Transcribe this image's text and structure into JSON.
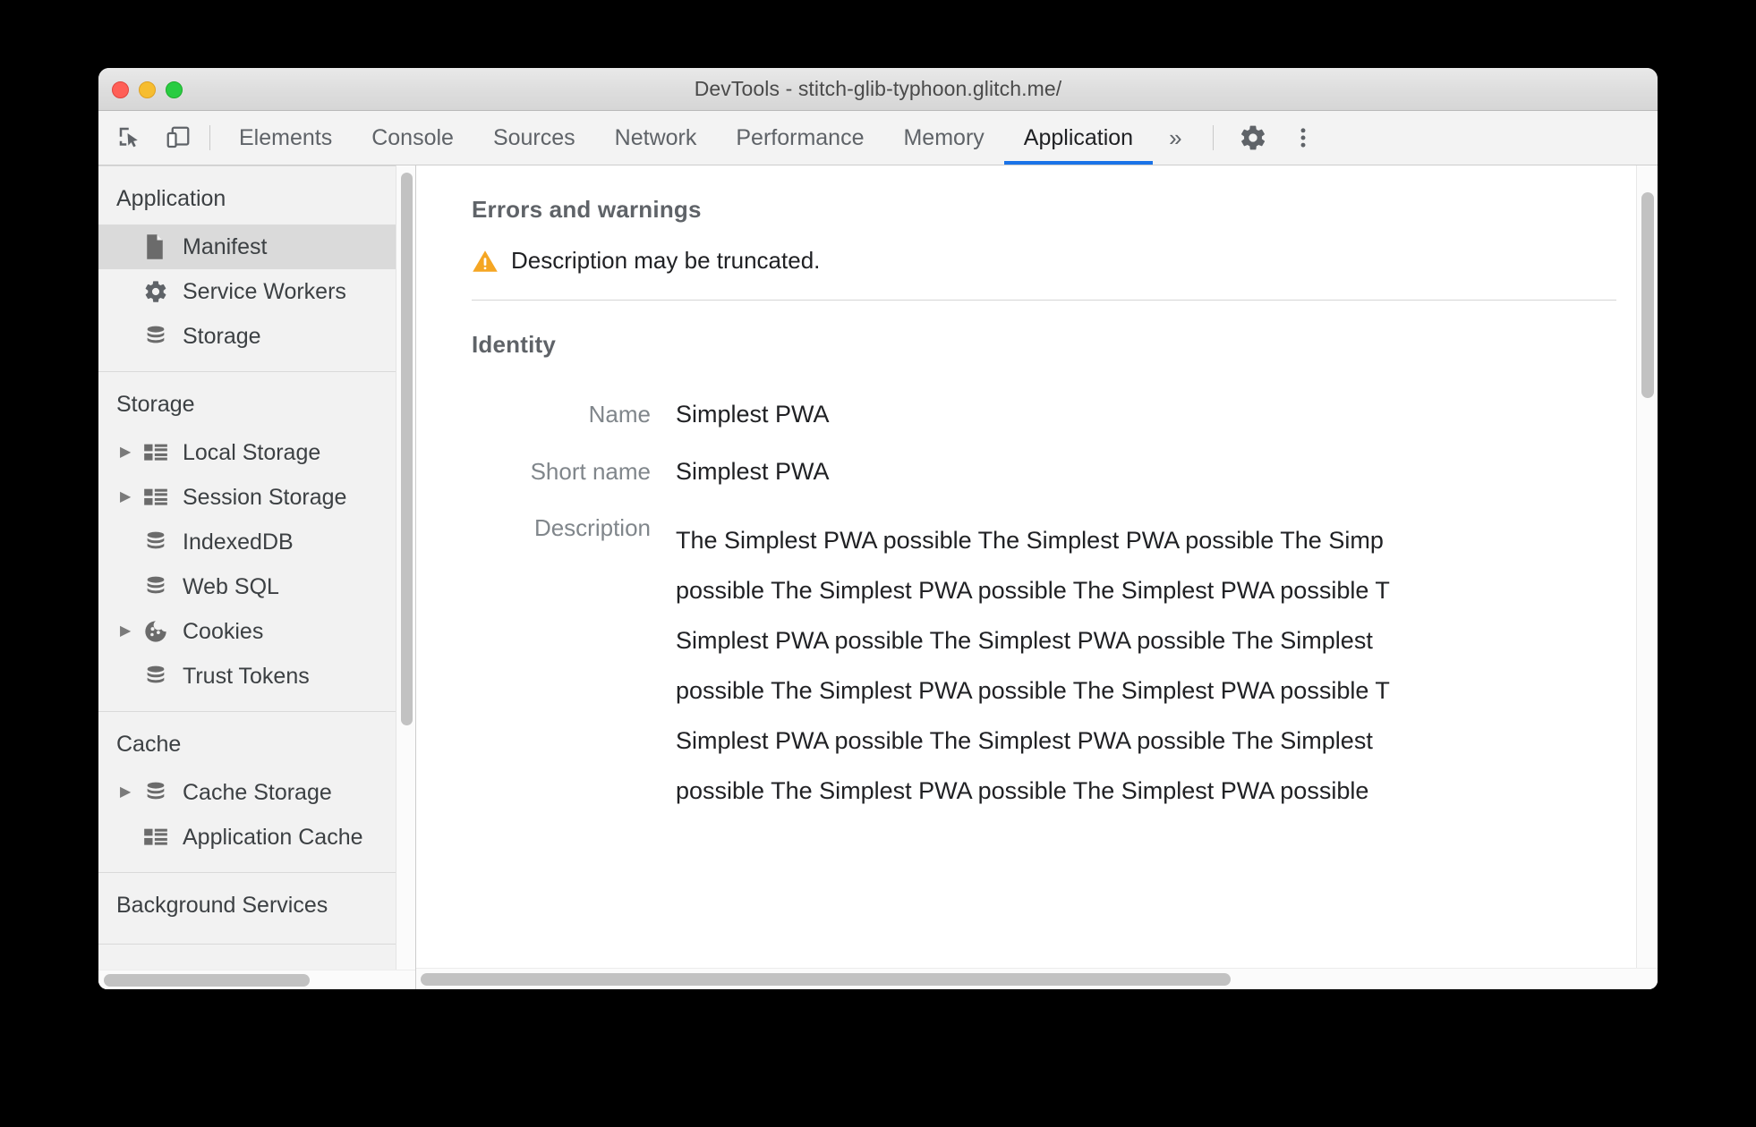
{
  "window": {
    "title": "DevTools - stitch-glib-typhoon.glitch.me/",
    "traffic_lights": [
      "close",
      "minimize",
      "zoom"
    ]
  },
  "toolbar": {
    "inspect_icon": "inspect-element-icon",
    "device_icon": "device-toolbar-icon",
    "more_tabs_label": "»",
    "settings_icon": "gear-icon",
    "more_options_icon": "kebab-menu-icon",
    "tabs": [
      {
        "label": "Elements",
        "active": false
      },
      {
        "label": "Console",
        "active": false
      },
      {
        "label": "Sources",
        "active": false
      },
      {
        "label": "Network",
        "active": false
      },
      {
        "label": "Performance",
        "active": false
      },
      {
        "label": "Memory",
        "active": false
      },
      {
        "label": "Application",
        "active": true
      }
    ],
    "active_tab": "Application",
    "accent_color": "#1a73e8"
  },
  "sidebar": {
    "groups": [
      {
        "title": "Application",
        "items": [
          {
            "label": "Manifest",
            "icon": "document-icon",
            "selected": true,
            "expandable": false
          },
          {
            "label": "Service Workers",
            "icon": "gear-icon",
            "selected": false,
            "expandable": false
          },
          {
            "label": "Storage",
            "icon": "database-icon",
            "selected": false,
            "expandable": false
          }
        ]
      },
      {
        "title": "Storage",
        "items": [
          {
            "label": "Local Storage",
            "icon": "table-icon",
            "selected": false,
            "expandable": true
          },
          {
            "label": "Session Storage",
            "icon": "table-icon",
            "selected": false,
            "expandable": true
          },
          {
            "label": "IndexedDB",
            "icon": "database-icon",
            "selected": false,
            "expandable": false
          },
          {
            "label": "Web SQL",
            "icon": "database-icon",
            "selected": false,
            "expandable": false
          },
          {
            "label": "Cookies",
            "icon": "cookie-icon",
            "selected": false,
            "expandable": true
          },
          {
            "label": "Trust Tokens",
            "icon": "database-icon",
            "selected": false,
            "expandable": false
          }
        ]
      },
      {
        "title": "Cache",
        "items": [
          {
            "label": "Cache Storage",
            "icon": "database-icon",
            "selected": false,
            "expandable": true
          },
          {
            "label": "Application Cache",
            "icon": "table-icon",
            "selected": false,
            "expandable": false
          }
        ]
      },
      {
        "title": "Background Services",
        "items": []
      }
    ]
  },
  "main": {
    "errors_section": {
      "heading": "Errors and warnings",
      "warning_icon": "warning-triangle-icon",
      "warning_color": "#f5a623",
      "message": "Description may be truncated."
    },
    "identity_section": {
      "heading": "Identity",
      "fields": [
        {
          "label": "Name",
          "value": "Simplest PWA"
        },
        {
          "label": "Short name",
          "value": "Simplest PWA"
        }
      ],
      "description_label": "Description",
      "description_lines": [
        "The Simplest PWA possible The Simplest PWA possible The Simp",
        "possible The Simplest PWA possible The Simplest PWA possible T",
        "Simplest PWA possible The Simplest PWA possible The Simplest",
        "possible The Simplest PWA possible The Simplest PWA possible T",
        "Simplest PWA possible The Simplest PWA possible The Simplest",
        "possible The Simplest PWA possible The Simplest PWA possible"
      ]
    }
  }
}
